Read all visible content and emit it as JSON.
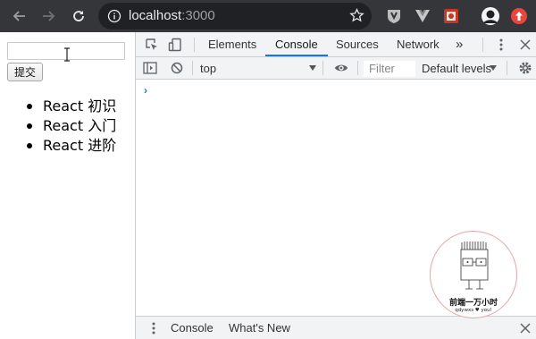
{
  "browser": {
    "url_host": "localhost",
    "url_port": ":3000"
  },
  "page": {
    "submit_label": "提交",
    "list_items": [
      "React 初识",
      "React 入门",
      "React 进阶"
    ]
  },
  "devtools": {
    "tabs": [
      "Elements",
      "Console",
      "Sources",
      "Network"
    ],
    "more_tabs": "»",
    "context": "top",
    "filter_placeholder": "Filter",
    "levels": "Default levels",
    "prompt": "›",
    "drawer_tabs": [
      "Console",
      "What's New"
    ]
  },
  "watermark": {
    "title": "前端一万小时",
    "subtitle": "qdywxs ♥ you!"
  }
}
